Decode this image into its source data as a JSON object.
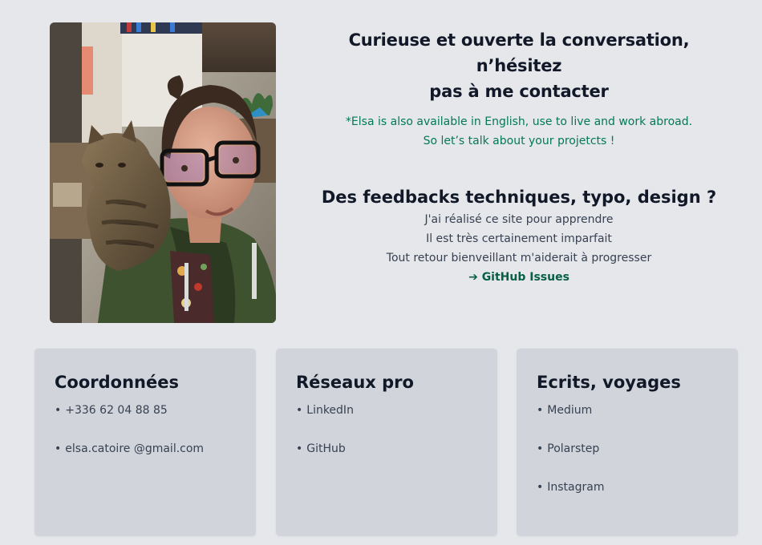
{
  "intro": {
    "title_line1": "Curieuse et ouverte la conversation, n’hésitez",
    "title_line2": "pas à me contacter",
    "note_line1": "*Elsa is also available in English, use to live and work abroad.",
    "note_line2": "So let’s talk about your projetcts !"
  },
  "feedback": {
    "title": "Des feedbacks techniques, typo, design ?",
    "lines": [
      "J'ai réalisé ce site pour apprendre",
      "Il est très certainement imparfait",
      "Tout retour bienveillant m'aiderait à progresser"
    ],
    "link_arrow": "➔",
    "link_label": "GitHub Issues"
  },
  "cards": [
    {
      "title": "Coordonnées",
      "items": [
        "+336 62 04 88 85",
        "elsa.catoire @gmail.com"
      ]
    },
    {
      "title": "Réseaux pro",
      "items": [
        "LinkedIn",
        "GitHub"
      ]
    },
    {
      "title": "Ecrits, voyages",
      "items": [
        "Medium",
        "Polarstep",
        "Instagram"
      ]
    }
  ],
  "bullet": "•",
  "colors": {
    "background": "#e5e7eb",
    "card": "#d1d5db",
    "accent_green": "#047857",
    "link_green": "#065f46"
  }
}
